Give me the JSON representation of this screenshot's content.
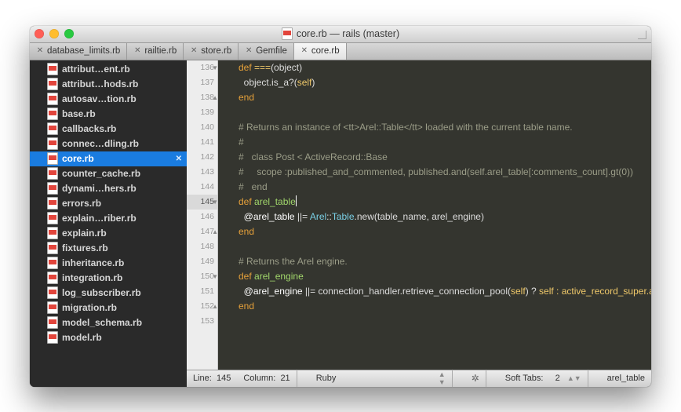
{
  "titlebar": {
    "title": "core.rb — rails (master)"
  },
  "tabs": [
    {
      "label": "database_limits.rb",
      "active": false
    },
    {
      "label": "railtie.rb",
      "active": false
    },
    {
      "label": "store.rb",
      "active": false
    },
    {
      "label": "Gemfile",
      "active": false
    },
    {
      "label": "core.rb",
      "active": true
    }
  ],
  "sidebar": {
    "files": [
      "attribut…ent.rb",
      "attribut…hods.rb",
      "autosav…tion.rb",
      "base.rb",
      "callbacks.rb",
      "connec…dling.rb",
      "core.rb",
      "counter_cache.rb",
      "dynami…hers.rb",
      "errors.rb",
      "explain…riber.rb",
      "explain.rb",
      "fixtures.rb",
      "inheritance.rb",
      "integration.rb",
      "log_subscriber.rb",
      "migration.rb",
      "model_schema.rb",
      "model.rb"
    ],
    "selected_index": 6
  },
  "editor": {
    "gutter": [
      {
        "n": "136",
        "mark": "down"
      },
      {
        "n": "137",
        "mark": ""
      },
      {
        "n": "138",
        "mark": "up"
      },
      {
        "n": "139",
        "mark": ""
      },
      {
        "n": "140",
        "mark": ""
      },
      {
        "n": "141",
        "mark": ""
      },
      {
        "n": "142",
        "mark": ""
      },
      {
        "n": "143",
        "mark": ""
      },
      {
        "n": "144",
        "mark": ""
      },
      {
        "n": "145",
        "mark": "down",
        "current": true
      },
      {
        "n": "146",
        "mark": ""
      },
      {
        "n": "147",
        "mark": "up"
      },
      {
        "n": "148",
        "mark": ""
      },
      {
        "n": "149",
        "mark": ""
      },
      {
        "n": "150",
        "mark": "down"
      },
      {
        "n": "151",
        "mark": ""
      },
      {
        "n": "152",
        "mark": "up"
      },
      {
        "n": "153",
        "mark": ""
      }
    ],
    "lines": {
      "l0_a": "      def ",
      "l0_b": "===",
      "l0_c": "(object)",
      "l1": "        object.is_a?(",
      "l1_b": "self",
      "l1_c": ")",
      "l2": "      end",
      "l3": "",
      "l4": "      # Returns an instance of <tt>Arel::Table</tt> loaded with the current",
      "l4b": " table name.",
      "l5": "      #",
      "l6": "      #   class Post < ActiveRecord::Base",
      "l7": "      #     scope :published_and_commented, ",
      "l7b": "published.and(self.arel_table[:comments_count].gt(0))",
      "l8": "      #   end",
      "l9_a": "      def ",
      "l9_b": "arel_table",
      "l10_a": "        ",
      "l10_b": "@arel_table",
      "l10_c": " ||= ",
      "l10_d": "Arel",
      "l10_e": "::",
      "l10_f": "Table",
      "l10_g": ".new(table_name, arel_engine)",
      "l11": "      end",
      "l12": "",
      "l13": "      # Returns the Arel engine.",
      "l14_a": "      def ",
      "l14_b": "arel_engine",
      "l15_a": "        ",
      "l15_b": "@arel_engine",
      "l15_c": " ||= connection_handler.retrieve_connection_pool(",
      "l15_d": "self",
      "l15_e": ") ? ",
      "l15_f": "self : active_record_super.arel_engine",
      "l16": "      end",
      "l17": ""
    }
  },
  "status": {
    "line_label": "Line:",
    "line": "145",
    "col_label": "Column:",
    "col": "21",
    "language": "Ruby",
    "softtabs_label": "Soft Tabs:",
    "softtabs": "2",
    "symbol": "arel_table"
  }
}
